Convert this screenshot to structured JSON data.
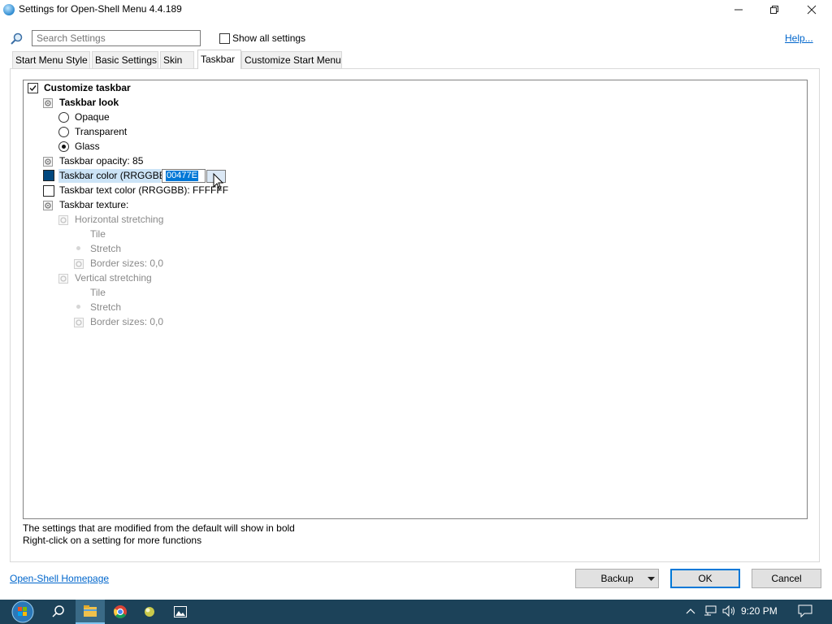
{
  "window": {
    "title": "Settings for Open-Shell Menu 4.4.189"
  },
  "search": {
    "placeholder": "Search Settings",
    "value": "",
    "show_all_label": "Show all settings",
    "show_all_checked": false,
    "help_label": "Help..."
  },
  "tabs": [
    {
      "label": "Start Menu Style",
      "active": false
    },
    {
      "label": "Basic Settings",
      "active": false
    },
    {
      "label": "Skin",
      "active": false
    },
    {
      "label": "Taskbar",
      "active": true
    },
    {
      "label": "Customize Start Menu",
      "active": false
    }
  ],
  "tree": {
    "customize_taskbar": "Customize taskbar",
    "customize_taskbar_checked": true,
    "taskbar_look": "Taskbar look",
    "opaque": "Opaque",
    "transparent": "Transparent",
    "glass": "Glass",
    "selected_look": "Glass",
    "opacity": "Taskbar opacity: 85",
    "color_label": "Taskbar color (RRGGBB)",
    "color_value": "00477E",
    "text_color": "Taskbar text color (RRGGBB): FFFFFF",
    "texture": "Taskbar texture:",
    "h_stretch": "Horizontal stretching",
    "h_tile": "Tile",
    "h_stretch_opt": "Stretch",
    "h_border": "Border sizes: 0,0",
    "v_stretch": "Vertical stretching",
    "v_tile": "Tile",
    "v_stretch_opt": "Stretch",
    "v_border": "Border sizes: 0,0"
  },
  "colors": {
    "taskbar_color": "#00477E",
    "text_color": "#FFFFFF",
    "accent": "#0078d7",
    "link": "#0066cc",
    "taskbar_bg": "#1c4259"
  },
  "footer": {
    "note1": "The settings that are modified from the default will show in bold",
    "note2": "Right-click on a setting for more functions",
    "homepage": "Open-Shell Homepage",
    "backup": "Backup",
    "ok": "OK",
    "cancel": "Cancel"
  },
  "taskbar": {
    "clock": "9:20 PM",
    "icons": [
      "start-icon",
      "search-icon",
      "file-explorer-icon",
      "chrome-icon",
      "app-icon",
      "photos-icon"
    ],
    "tray_icons": [
      "chevron-up-icon",
      "network-icon",
      "volume-icon",
      "notification-icon"
    ]
  }
}
